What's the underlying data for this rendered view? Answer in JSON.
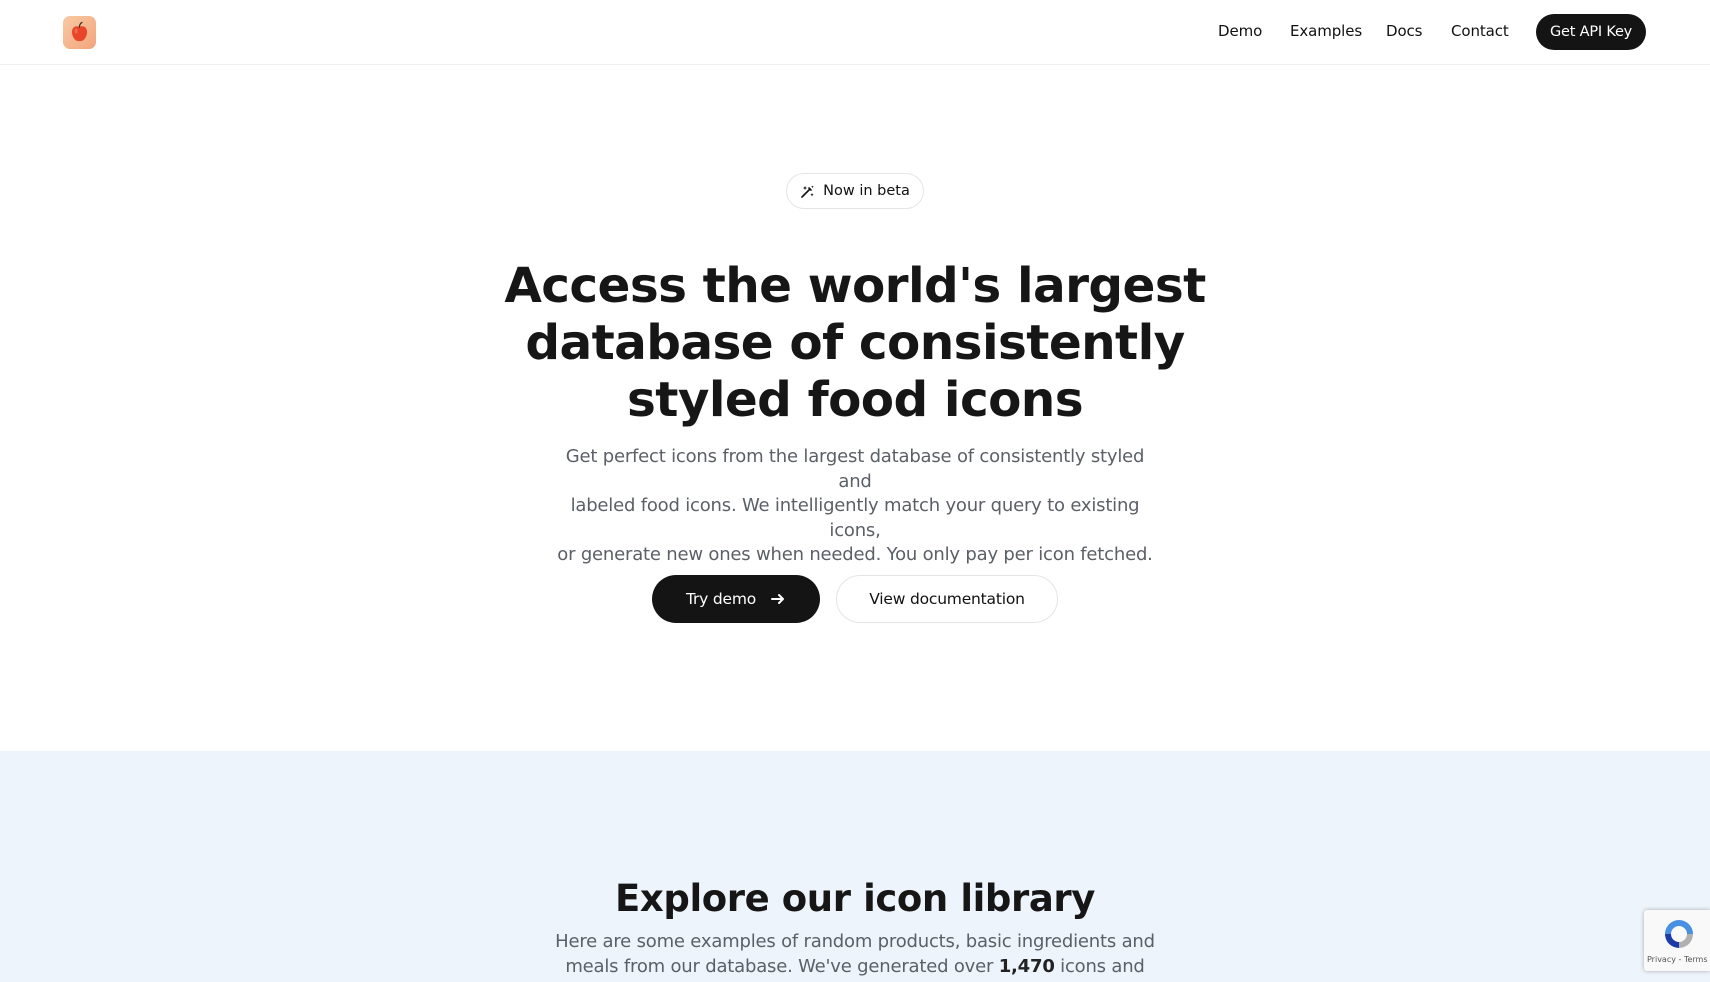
{
  "nav": {
    "links": [
      "Demo",
      "Examples",
      "Docs",
      "Contact"
    ],
    "cta_label": "Get API Key"
  },
  "hero": {
    "badge": "Now in beta",
    "headline_lines": [
      "Access the world's largest",
      "database of consistently",
      "styled food icons"
    ],
    "subhead_lines": [
      "Get perfect icons from the largest database of consistently styled and",
      "labeled food icons. We intelligently match your query to existing icons,",
      "or generate new ones when needed. You only pay per icon fetched."
    ],
    "primary_button": "Try demo",
    "secondary_button": "View documentation"
  },
  "library": {
    "title": "Explore our icon library",
    "text_line1": "Here are some examples of random products, basic ingredients and",
    "text_line2_before": "meals from our database. We've generated over ",
    "icon_count": "1,470",
    "text_line2_after": " icons and are"
  },
  "recaptcha": {
    "links": "Privacy - Terms"
  },
  "colors": {
    "primary": "#141414",
    "library_bg": "#eef4fb",
    "muted_text": "#5b5f66"
  }
}
